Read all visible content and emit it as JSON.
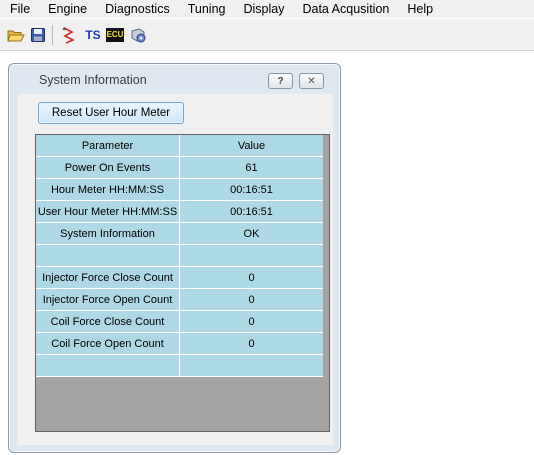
{
  "menu": {
    "items": [
      {
        "label": "File",
        "name": "menu-file"
      },
      {
        "label": "Engine",
        "name": "menu-engine"
      },
      {
        "label": "Diagnostics",
        "name": "menu-diagnostics"
      },
      {
        "label": "Tuning",
        "name": "menu-tuning"
      },
      {
        "label": "Display",
        "name": "menu-display"
      },
      {
        "label": "Data Acqusition",
        "name": "menu-data-acquisition"
      },
      {
        "label": "Help",
        "name": "menu-help"
      }
    ]
  },
  "toolbar": {
    "icons": [
      "open-folder-icon",
      "save-icon",
      "graph-icon",
      "ts-icon",
      "ecu-icon",
      "config-icon"
    ],
    "ts_label": "TS",
    "ecu_label": "ECU"
  },
  "window": {
    "title": "System Information",
    "help_glyph": "?",
    "close_glyph": "✕",
    "reset_button_label": "Reset User Hour Meter"
  },
  "table": {
    "headers": [
      "Parameter",
      "Value"
    ],
    "rows": [
      {
        "parameter": "Power On Events",
        "value": "61"
      },
      {
        "parameter": "Hour Meter HH:MM:SS",
        "value": "00:16:51"
      },
      {
        "parameter": "User Hour Meter HH:MM:SS",
        "value": "00:16:51"
      },
      {
        "parameter": "System Information",
        "value": "OK"
      },
      {
        "parameter": "",
        "value": ""
      },
      {
        "parameter": "Injector Force Close Count",
        "value": "0"
      },
      {
        "parameter": "Injector Force Open Count",
        "value": "0"
      },
      {
        "parameter": "Coil Force Close Count",
        "value": "0"
      },
      {
        "parameter": "Coil Force Open Count",
        "value": "0"
      },
      {
        "parameter": "",
        "value": ""
      }
    ]
  },
  "colors": {
    "row_background": "#add8e6",
    "grid_background": "#a4a4a4",
    "window_frame": "#dfe7f0"
  }
}
